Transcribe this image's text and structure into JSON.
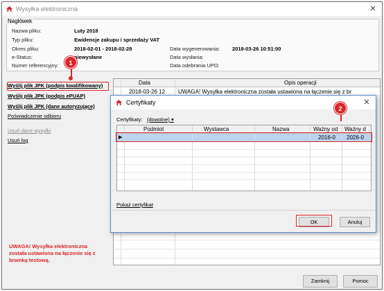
{
  "window": {
    "title": "Wysyłka elektroniczna"
  },
  "header": {
    "legend": "Nagłówek",
    "fields": [
      {
        "label": "Nazwa pliku:",
        "value": "Luty 2018"
      },
      {
        "label": "Typ pliku:",
        "value": "Ewidencje zakupu i sprzedaży VAT"
      },
      {
        "label": "Okres pliku:",
        "value": "2018-02-01 - 2018-02-28"
      },
      {
        "label": "e-Status:",
        "value": "niewysłane"
      },
      {
        "label": "Numer referencyjny:",
        "value": ""
      }
    ],
    "right_fields": [
      {
        "label": "Data wygenerowania:",
        "value": "2018-03-26 10:51:00"
      },
      {
        "label": "Data wysłania:",
        "value": ""
      },
      {
        "label": "Data odebrania UPO:",
        "value": ""
      }
    ]
  },
  "actions": {
    "send_qualified": "Wyślij plik JPK (podpis kwalifikowany)",
    "send_epuap": "Wyślij plik JPK (podpis ePUAP)",
    "send_auth": "Wyślij plik JPK (dane autoryzujące)",
    "confirm_receipt": "Poświadczenie odbioru",
    "delete_shipment": "Usuń dane wysyłki",
    "delete_log": "Usuń log"
  },
  "warning": "UWAGA! Wysyłka elektroniczna została ustawiona na łączenie się z bramką testową.",
  "log_grid": {
    "columns": [
      "Data",
      "Opis operacji"
    ],
    "rows": [
      {
        "date": "2018-03-26 12",
        "desc": "UWAGA! Wysyłka elektroniczna została ustawiona na łączenie się z br"
      }
    ]
  },
  "footer": {
    "close_label": "Zamknij",
    "help_label": "Pomoc"
  },
  "badges": {
    "one": "1",
    "two": "2"
  },
  "dialog": {
    "title": "Certyfikaty",
    "filter_label": "Certyfikaty:",
    "filter_value": "(dowolne)",
    "columns": [
      "Podmiot",
      "Wystawca",
      "Nazwa",
      "Ważny od",
      "Ważny d"
    ],
    "row": {
      "indicator": "▶",
      "valid_from": "2016-0",
      "valid_to": "2026-0"
    },
    "show_cert_label": "Pokaż certyfikat",
    "ok_label": "OK",
    "cancel_label": "Anuluj"
  },
  "colors": {
    "accent_red": "#d9262c",
    "selection": "#bcd3ee",
    "dialog_border": "#5c8bc6"
  }
}
